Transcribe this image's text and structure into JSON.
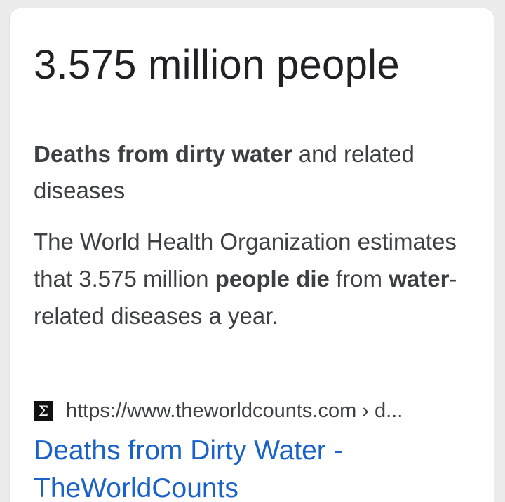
{
  "featured_snippet": {
    "answer": "3.575 million people",
    "subtitle": {
      "bold": "Deaths from dirty water",
      "rest": " and related diseases"
    },
    "snippet": {
      "part1": "The World Health Organization estimates that 3.575 million ",
      "bold1": "people die",
      "part2": " from ",
      "bold2": "water",
      "part3": "-related diseases a year."
    },
    "source": {
      "favicon_glyph": "Σ",
      "favicon_icon": "sigma-icon",
      "url": "https://www.theworldcounts.com › d..."
    },
    "result_link": {
      "title": "Deaths from Dirty Water - TheWorldCounts",
      "color": "#1a62c7"
    }
  }
}
